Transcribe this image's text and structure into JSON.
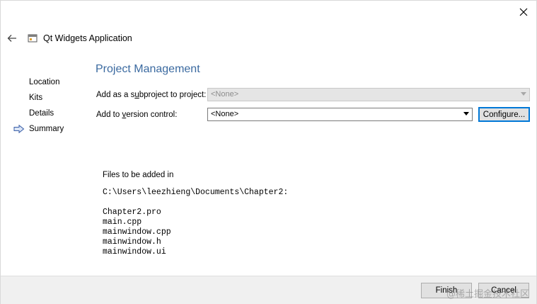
{
  "window": {
    "title": "Qt Widgets Application"
  },
  "nav": {
    "items": [
      {
        "label": "Location",
        "active": false
      },
      {
        "label": "Kits",
        "active": false
      },
      {
        "label": "Details",
        "active": false
      },
      {
        "label": "Summary",
        "active": true
      }
    ]
  },
  "page": {
    "heading": "Project Management",
    "subproject": {
      "label_pre": "Add as a s",
      "label_accel": "u",
      "label_post": "bproject to project:",
      "value": "<None>",
      "enabled": false
    },
    "version_control": {
      "label_pre": "Add to ",
      "label_accel": "v",
      "label_post": "ersion control:",
      "value": "<None>"
    },
    "configure_label": "Configure...",
    "summary": {
      "intro": "Files to be added in",
      "path": "C:\\Users\\leezhieng\\Documents\\Chapter2:",
      "files": [
        "Chapter2.pro",
        "main.cpp",
        "mainwindow.cpp",
        "mainwindow.h",
        "mainwindow.ui"
      ]
    }
  },
  "footer": {
    "finish_label": "Finish",
    "cancel_label": "Cancel"
  },
  "watermark": "@稀土掘金技术社区",
  "icons": {
    "close": "close-icon",
    "back": "back-arrow-icon",
    "app": "qt-app-window-icon",
    "current_step": "current-step-arrow-icon"
  },
  "colors": {
    "heading": "#3b6aa0",
    "focus": "#0078d7",
    "nav_arrow": "#3a5fa8"
  }
}
